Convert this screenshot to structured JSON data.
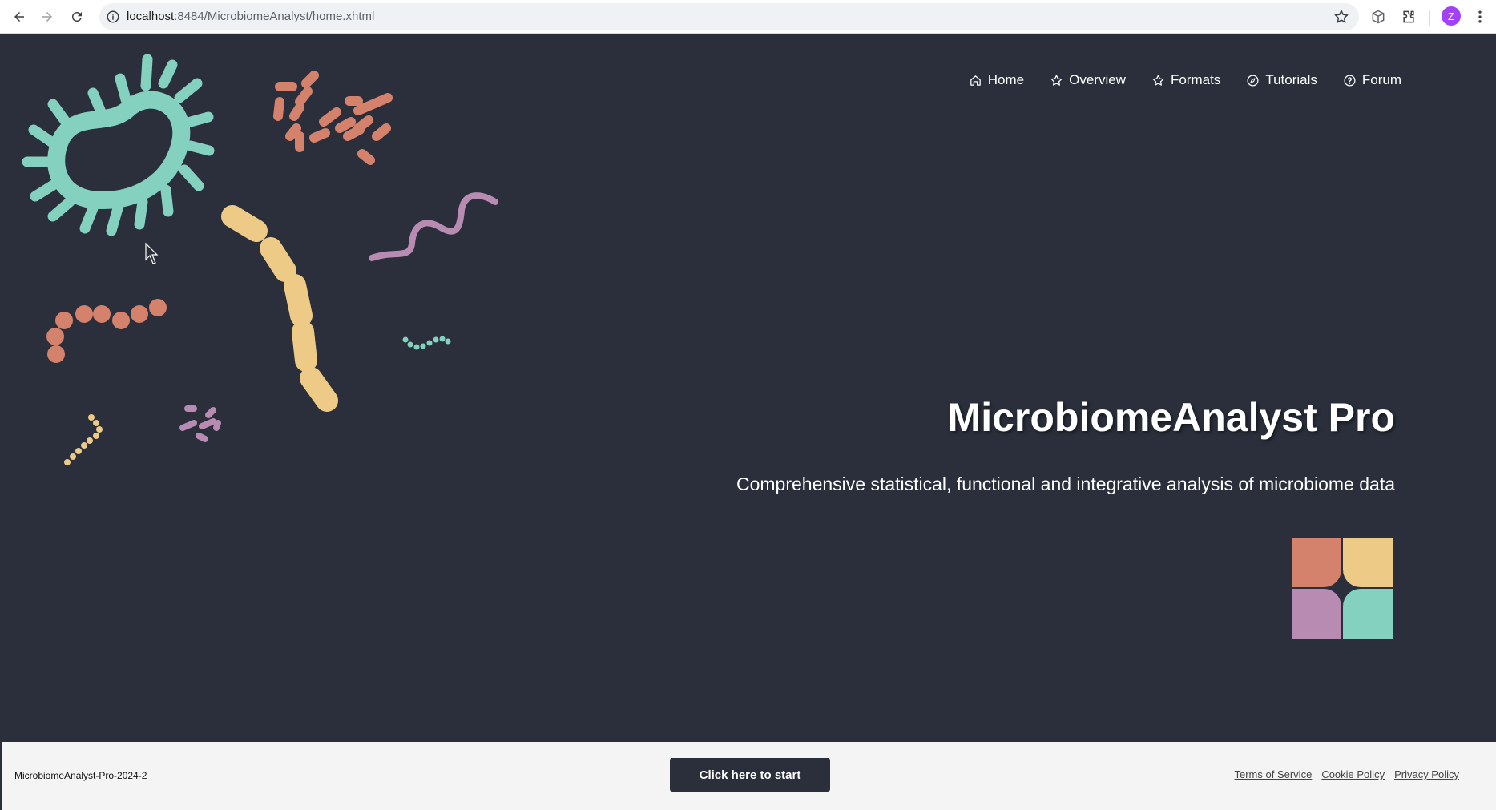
{
  "browser": {
    "url_host": "localhost",
    "url_rest": ":8484/MicrobiomeAnalyst/home.xhtml",
    "profile_initial": "Z",
    "icons": [
      "back-arrow-icon",
      "forward-arrow-icon",
      "reload-icon",
      "site-info-icon",
      "bookmark-star-icon",
      "extension-icon",
      "puzzle-icon",
      "kebab-menu-icon"
    ]
  },
  "nav": {
    "items": [
      {
        "label": "Home",
        "icon": "home-icon"
      },
      {
        "label": "Overview",
        "icon": "star-icon"
      },
      {
        "label": "Formats",
        "icon": "star-icon"
      },
      {
        "label": "Tutorials",
        "icon": "compass-icon"
      },
      {
        "label": "Forum",
        "icon": "question-icon"
      }
    ]
  },
  "hero": {
    "title": "MicrobiomeAnalyst Pro",
    "subtitle": "Comprehensive statistical, functional and integrative analysis of microbiome data"
  },
  "footer": {
    "version": "MicrobiomeAnalyst-Pro-2024-2",
    "start_button": "Click here to start",
    "links": [
      "Terms of Service",
      "Cookie Policy",
      "Privacy Policy"
    ]
  },
  "colors": {
    "background": "#2a2f3b",
    "teal": "#85d1bf",
    "salmon": "#d4826c",
    "yellow": "#edca86",
    "purple": "#b88bb2",
    "footer_bg": "#f4f4f4"
  }
}
